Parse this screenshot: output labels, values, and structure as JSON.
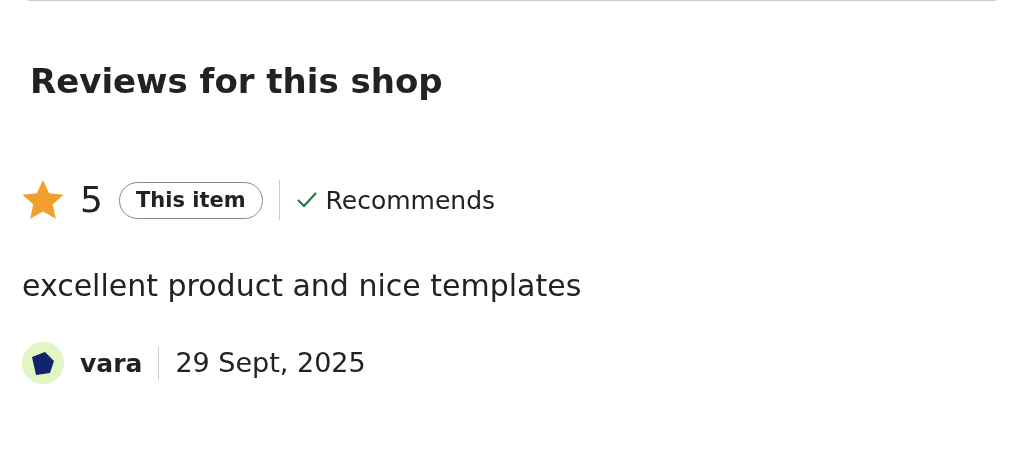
{
  "heading": "Reviews for this shop",
  "review": {
    "rating": "5",
    "tag": "This item",
    "recommends": "Recommends",
    "text": "excellent product and nice templates",
    "author": "vara",
    "date": "29 Sept, 2025"
  }
}
